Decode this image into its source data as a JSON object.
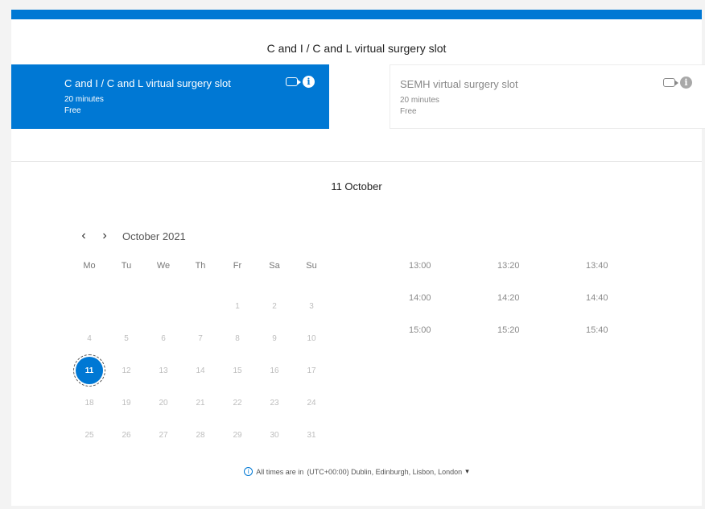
{
  "service_title": "C and I / C and L virtual surgery slot",
  "services": [
    {
      "name": "C and I / C and L virtual surgery slot",
      "duration": "20 minutes",
      "price": "Free",
      "selected": true,
      "icons": [
        "video-icon",
        "info-icon"
      ]
    },
    {
      "name": "SEMH virtual surgery slot",
      "duration": "20 minutes",
      "price": "Free",
      "selected": false,
      "icons": [
        "video-icon",
        "info-icon"
      ]
    }
  ],
  "date_heading": "11 October",
  "calendar": {
    "prev_label": "‹",
    "next_label": "›",
    "month_label": "October 2021",
    "weekdays": [
      "Mo",
      "Tu",
      "We",
      "Th",
      "Fr",
      "Sa",
      "Su"
    ],
    "leading_blanks": 4,
    "days": [
      "1",
      "2",
      "3",
      "4",
      "5",
      "6",
      "7",
      "8",
      "9",
      "10",
      "11",
      "12",
      "13",
      "14",
      "15",
      "16",
      "17",
      "18",
      "19",
      "20",
      "21",
      "22",
      "23",
      "24",
      "25",
      "26",
      "27",
      "28",
      "29",
      "30",
      "31"
    ],
    "selected_day": "11"
  },
  "time_slots": [
    "13:00",
    "13:20",
    "13:40",
    "14:00",
    "14:20",
    "14:40",
    "15:00",
    "15:20",
    "15:40"
  ],
  "timezone": {
    "prefix": "All times are in",
    "value": "(UTC+00:00) Dublin, Edinburgh, Lisbon, London",
    "caret": "▾"
  },
  "colors": {
    "accent": "#0078d4"
  }
}
